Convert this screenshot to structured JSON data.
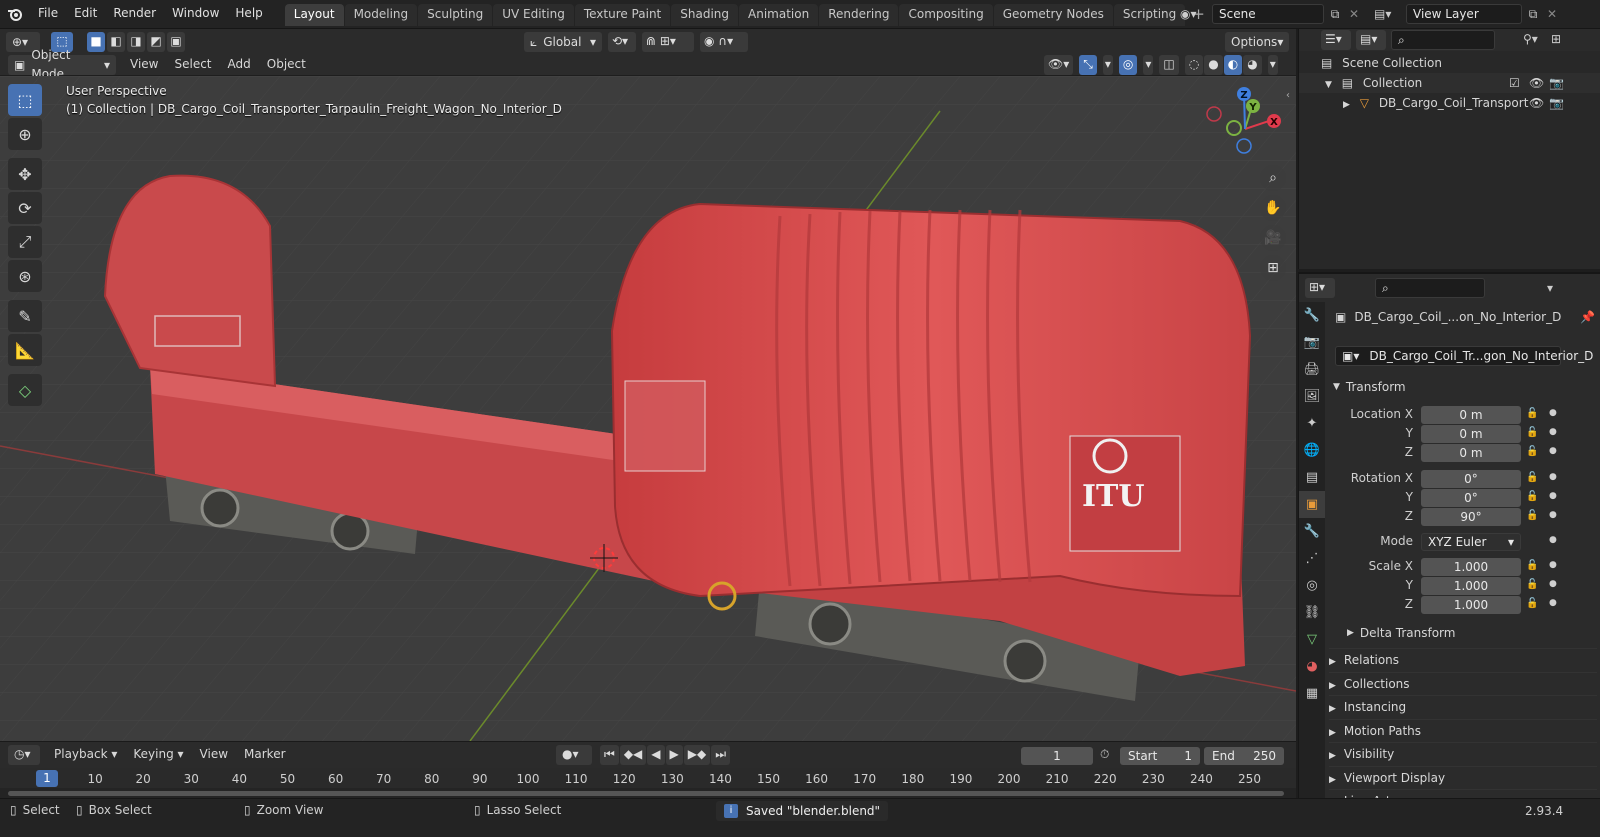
{
  "app": {
    "menu": [
      "File",
      "Edit",
      "Render",
      "Window",
      "Help"
    ],
    "workspaces": [
      "Layout",
      "Modeling",
      "Sculpting",
      "UV Editing",
      "Texture Paint",
      "Shading",
      "Animation",
      "Rendering",
      "Compositing",
      "Geometry Nodes",
      "Scripting"
    ],
    "active_workspace": "Layout",
    "scene_name": "Scene",
    "view_layer": "View Layer"
  },
  "viewport": {
    "transform_orientation": "Global",
    "options_label": "Options",
    "mode": "Object Mode",
    "header_menus": [
      "View",
      "Select",
      "Add",
      "Object"
    ],
    "perspective_text": "User Perspective",
    "collection_text": "(1) Collection | DB_Cargo_Coil_Transporter_Tarpaulin_Freight_Wagon_No_Interior_D",
    "gizmo_axes": [
      "X",
      "Y",
      "Z"
    ]
  },
  "timeline": {
    "menus": [
      "Playback",
      "Keying",
      "View",
      "Marker"
    ],
    "current_frame": "1",
    "start_label": "Start",
    "start_value": "1",
    "end_label": "End",
    "end_value": "250",
    "ticks": [
      "1",
      "10",
      "20",
      "30",
      "40",
      "50",
      "60",
      "70",
      "80",
      "90",
      "100",
      "110",
      "120",
      "130",
      "140",
      "150",
      "160",
      "170",
      "180",
      "190",
      "200",
      "210",
      "220",
      "230",
      "240",
      "250"
    ]
  },
  "statusbar": {
    "select": "Select",
    "box_select": "Box Select",
    "zoom_view": "Zoom View",
    "lasso_select": "Lasso Select",
    "message": "Saved \"blender.blend\"",
    "version": "2.93.4"
  },
  "outliner": {
    "scene_collection": "Scene Collection",
    "collection": "Collection",
    "object": "DB_Cargo_Coil_Transport"
  },
  "properties": {
    "object_name": "DB_Cargo_Coil_...on_No_Interior_D",
    "data_name": "DB_Cargo_Coil_Tr...gon_No_Interior_D",
    "transform_title": "Transform",
    "location_label": "Location X",
    "rotation_label": "Rotation X",
    "scale_label": "Scale X",
    "y_label": "Y",
    "z_label": "Z",
    "mode_label": "Mode",
    "location": [
      "0 m",
      "0 m",
      "0 m"
    ],
    "rotation": [
      "0°",
      "0°",
      "90°"
    ],
    "rotation_mode": "XYZ Euler",
    "scale": [
      "1.000",
      "1.000",
      "1.000"
    ],
    "delta_transform": "Delta Transform",
    "panels": [
      "Relations",
      "Collections",
      "Instancing",
      "Motion Paths",
      "Visibility",
      "Viewport Display",
      "Line Art"
    ]
  },
  "colors": {
    "accent": "#4772b3",
    "wagon_red": "#d94b4b",
    "grid_bg": "#3c3c3c"
  }
}
